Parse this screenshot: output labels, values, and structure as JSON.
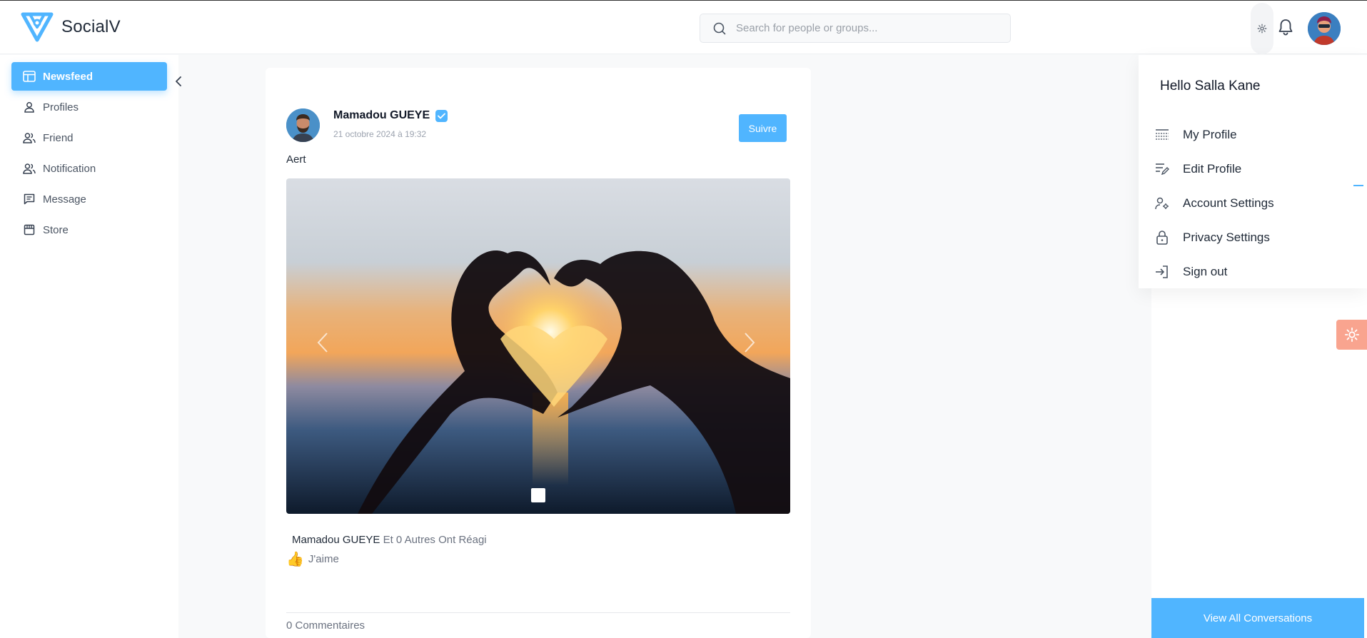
{
  "app": {
    "name": "SocialV"
  },
  "header": {
    "search": {
      "placeholder": "Search for people or groups..."
    },
    "icons": {
      "settings": "gear-icon",
      "notifications": "bell-icon",
      "profile": "avatar"
    }
  },
  "sidebar": {
    "items": [
      {
        "label": "Newsfeed",
        "icon": "newsfeed-icon",
        "active": true
      },
      {
        "label": "Profiles",
        "icon": "user-icon",
        "active": false
      },
      {
        "label": "Friend",
        "icon": "users-icon",
        "active": false
      },
      {
        "label": "Notification",
        "icon": "users-icon",
        "active": false
      },
      {
        "label": "Message",
        "icon": "message-icon",
        "active": false
      },
      {
        "label": "Store",
        "icon": "store-icon",
        "active": false
      }
    ]
  },
  "post": {
    "author": "Mamadou GUEYE",
    "date": "21 octobre 2024 à 19:32",
    "follow_label": "Suivre",
    "text": "Aert",
    "reactions": {
      "name": "Mamadou GUEYE",
      "suffix": "Et 0 Autres Ont Réagi"
    },
    "like_label": "J'aime",
    "comments_label": "0 Commentaires"
  },
  "dropdown": {
    "greeting": "Hello Salla Kane",
    "items": [
      {
        "label": "My Profile",
        "icon": "profile-card-icon"
      },
      {
        "label": "Edit Profile",
        "icon": "edit-profile-icon"
      },
      {
        "label": "Account Settings",
        "icon": "account-settings-icon"
      },
      {
        "label": "Privacy Settings",
        "icon": "lock-icon"
      },
      {
        "label": "Sign out",
        "icon": "sign-out-icon"
      }
    ]
  },
  "chat": {
    "view_all_label": "View All Conversations"
  },
  "colors": {
    "accent": "#50b5ff",
    "fab": "#f9a48f"
  }
}
